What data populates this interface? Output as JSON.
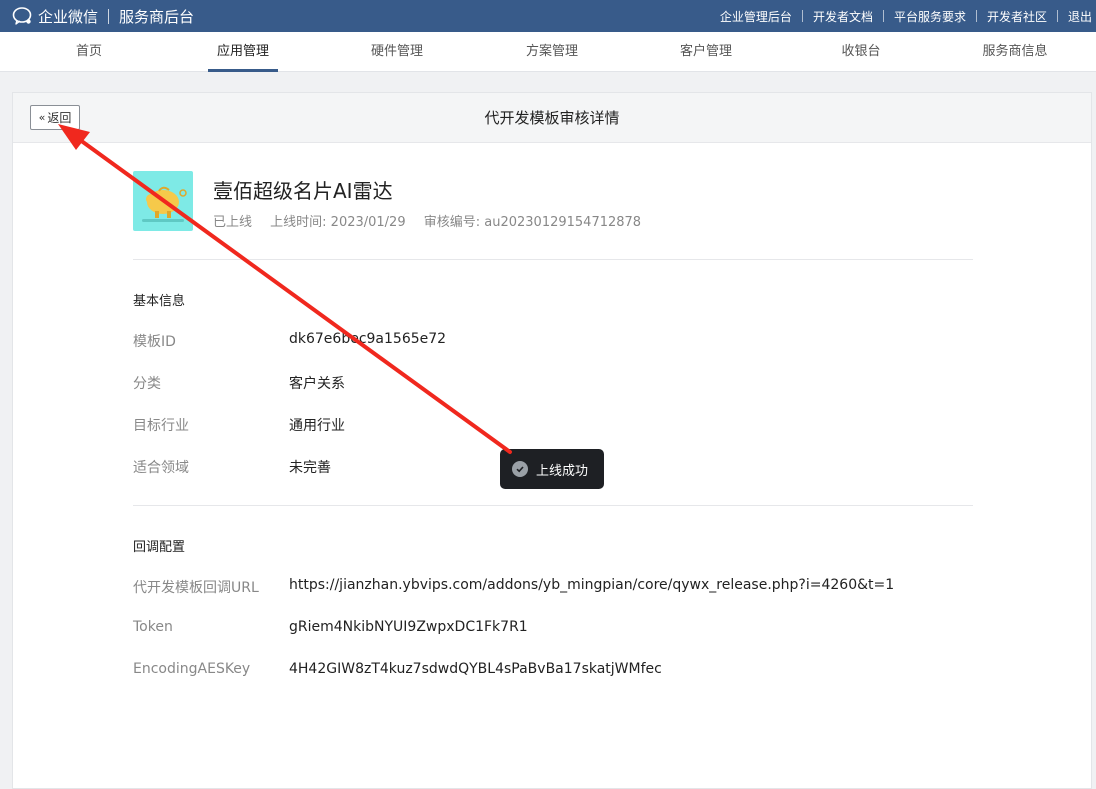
{
  "topbar": {
    "brand_name": "企业微信",
    "brand_sub": "服务商后台",
    "links": [
      "企业管理后台",
      "开发者文档",
      "平台服务要求",
      "开发者社区",
      "退出"
    ]
  },
  "nav": {
    "items": [
      "首页",
      "应用管理",
      "硬件管理",
      "方案管理",
      "客户管理",
      "收银台",
      "服务商信息"
    ],
    "active": "应用管理"
  },
  "panel": {
    "back_label": "返回",
    "title": "代开发模板审核详情"
  },
  "app": {
    "name": "壹佰超级名片AI雷达",
    "status": "已上线",
    "online_time": "上线时间: 2023/01/29",
    "audit_no": "审核编号: au20230129154712878"
  },
  "basic": {
    "title": "基本信息",
    "rows": [
      {
        "label": "模板ID",
        "value": "dk67e6bec9a1565e72"
      },
      {
        "label": "分类",
        "value": "客户关系"
      },
      {
        "label": "目标行业",
        "value": "通用行业"
      },
      {
        "label": "适合领域",
        "value": "未完善"
      }
    ]
  },
  "callback": {
    "title": "回调配置",
    "rows": [
      {
        "label": "代开发模板回调URL",
        "value": "https://jianzhan.ybvips.com/addons/yb_mingpian/core/qywx_release.php?i=4260&t=1"
      },
      {
        "label": "Token",
        "value": "gRiem4NkibNYUI9ZwpxDC1Fk7R1"
      },
      {
        "label": "EncodingAESKey",
        "value": "4H42GIW8zT4kuz7sdwdQYBL4sPaBvBa17skatjWMfec"
      }
    ]
  },
  "toast": {
    "text": "上线成功"
  },
  "colors": {
    "topbar": "#385b8a",
    "annotation_arrow": "#f0281e",
    "app_icon_bg": "#7eeae6"
  }
}
